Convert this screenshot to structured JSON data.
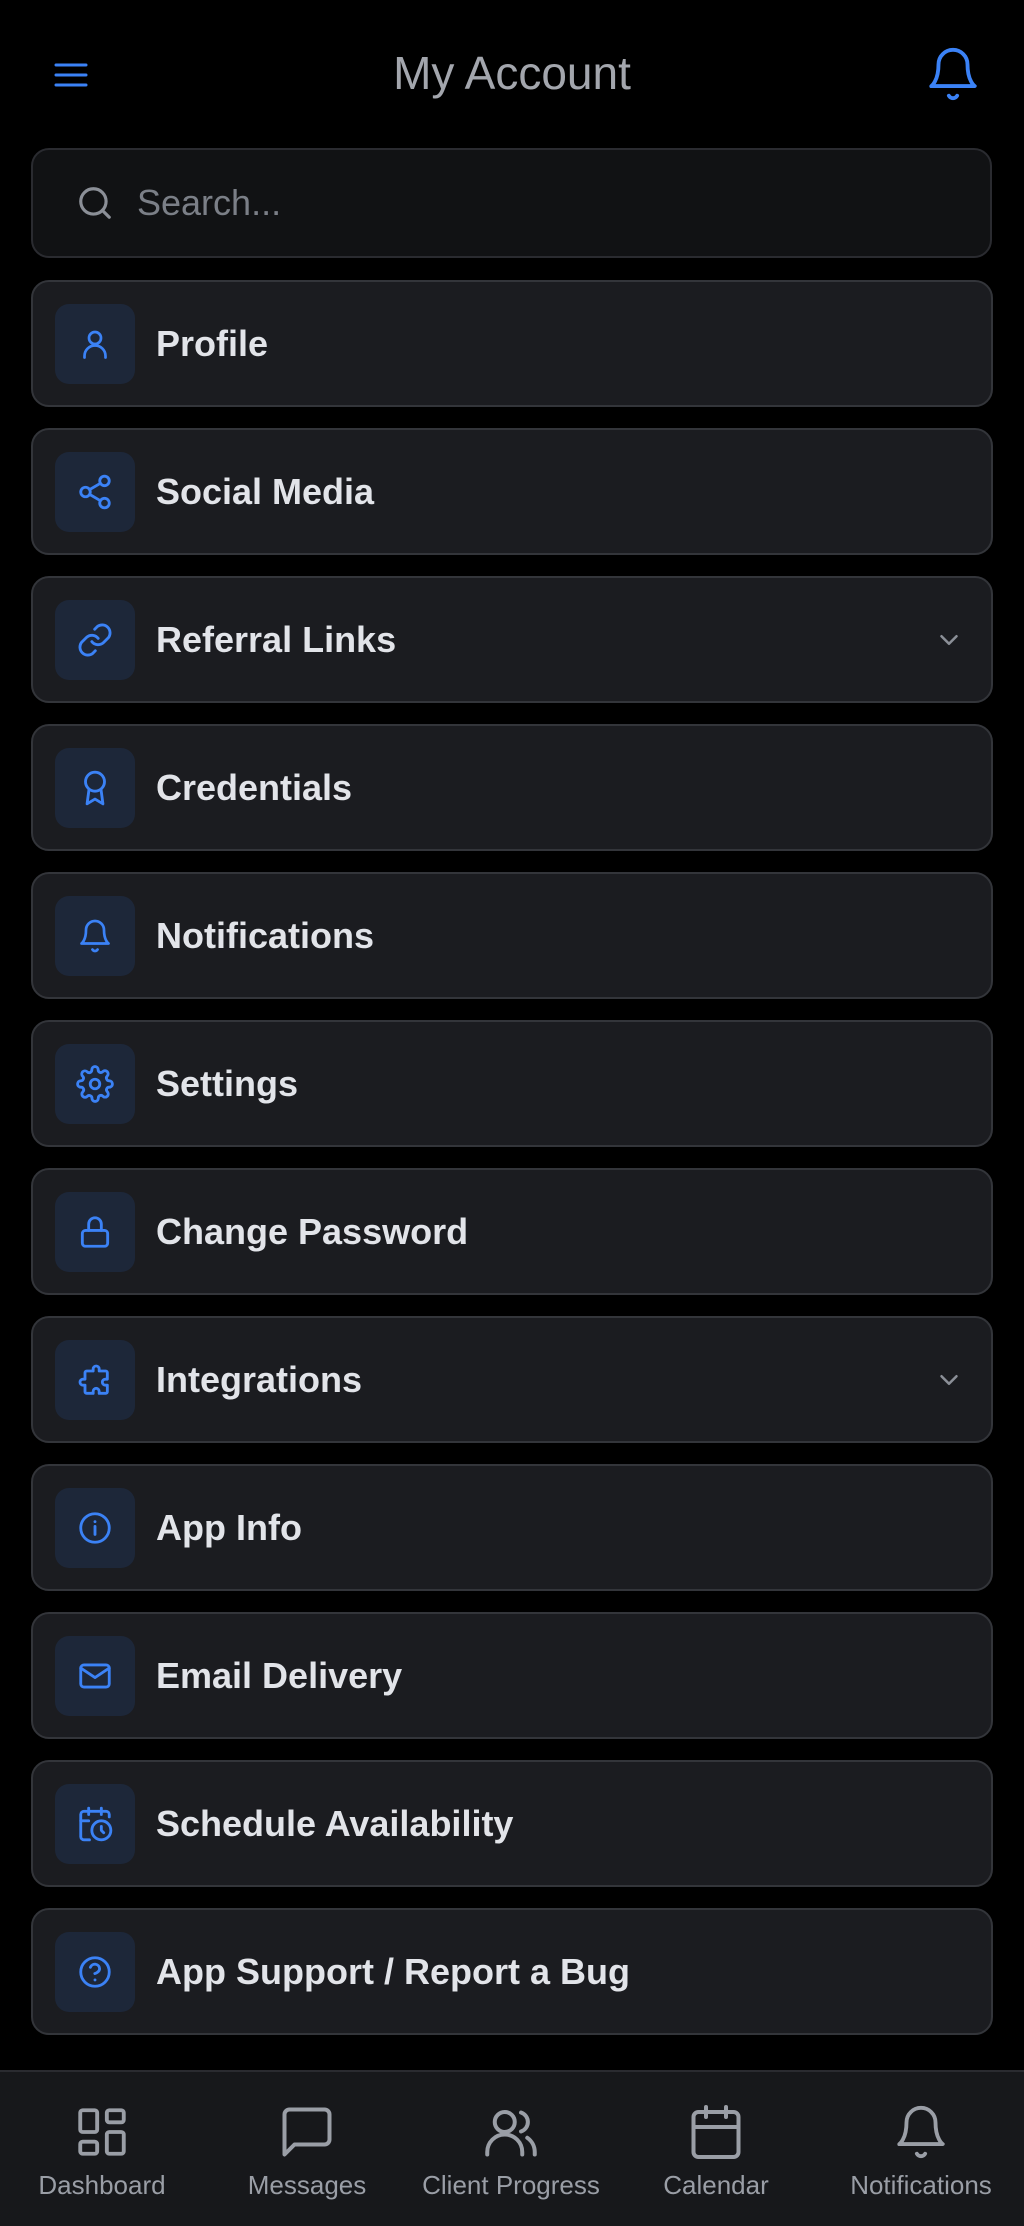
{
  "colors": {
    "accent": "#3b82f6",
    "background": "#000000",
    "card": "#1b1c20",
    "icon_box": "#1d2739",
    "text": "#e2e4e9",
    "muted": "#9a9ea6"
  },
  "header": {
    "title": "My Account",
    "menu_icon": "hamburger-menu-icon",
    "bell_icon": "bell-icon"
  },
  "search": {
    "placeholder": "Search...",
    "value": "",
    "icon": "search-icon"
  },
  "menu": {
    "items": [
      {
        "label": "Profile",
        "icon": "user-icon",
        "expandable": false
      },
      {
        "label": "Social Media",
        "icon": "share-icon",
        "expandable": false
      },
      {
        "label": "Referral Links",
        "icon": "link-icon",
        "expandable": true
      },
      {
        "label": "Credentials",
        "icon": "award-icon",
        "expandable": false
      },
      {
        "label": "Notifications",
        "icon": "bell-icon",
        "expandable": false
      },
      {
        "label": "Settings",
        "icon": "gear-icon",
        "expandable": false
      },
      {
        "label": "Change Password",
        "icon": "lock-icon",
        "expandable": false
      },
      {
        "label": "Integrations",
        "icon": "puzzle-icon",
        "expandable": true
      },
      {
        "label": "App Info",
        "icon": "info-icon",
        "expandable": false
      },
      {
        "label": "Email Delivery",
        "icon": "mail-icon",
        "expandable": false
      },
      {
        "label": "Schedule Availability",
        "icon": "calendar-clock-icon",
        "expandable": false
      },
      {
        "label": "App Support / Report a Bug",
        "icon": "help-circle-icon",
        "expandable": false
      }
    ]
  },
  "bottom_nav": {
    "items": [
      {
        "label": "Dashboard",
        "icon": "dashboard-grid-icon"
      },
      {
        "label": "Messages",
        "icon": "message-square-icon"
      },
      {
        "label": "Client Progress",
        "icon": "users-icon"
      },
      {
        "label": "Calendar",
        "icon": "calendar-icon"
      },
      {
        "label": "Notifications",
        "icon": "bell-icon"
      }
    ]
  }
}
